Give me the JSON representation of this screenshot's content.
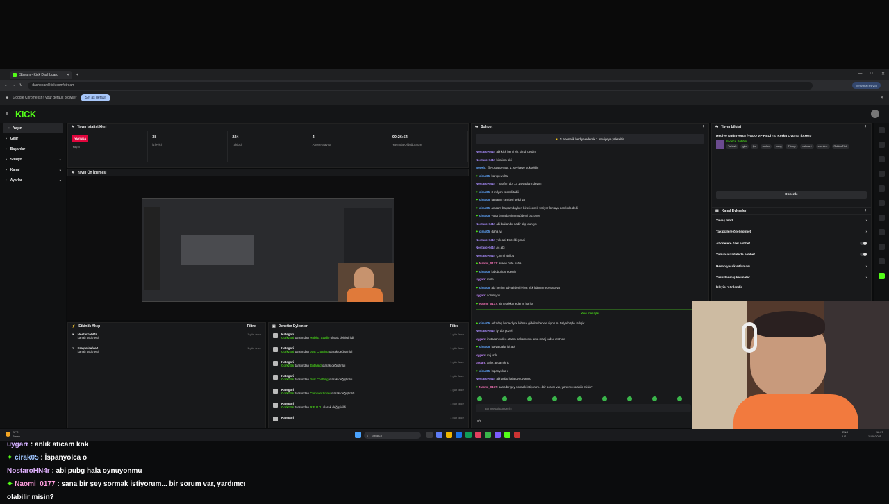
{
  "browser": {
    "tab_title": "Stream - Kick Dashboard",
    "url": "dashboard.kick.com/stream",
    "verify_label": "Verify that it's you",
    "infobar_text": "Google Chrome isn't your default browser",
    "set_default_label": "Set as default"
  },
  "brand": {
    "logo": "KICK",
    "accent": "#53fc18",
    "live_color": "#e1063d"
  },
  "sidebar": {
    "items": [
      {
        "label": "Yayın",
        "icon": "broadcast-icon"
      },
      {
        "label": "Gelir",
        "icon": "dollar-icon"
      },
      {
        "label": "Başarılar",
        "icon": "trophy-icon"
      },
      {
        "label": "Stüdyo",
        "icon": "studio-icon"
      },
      {
        "label": "Kanal",
        "icon": "channel-icon"
      },
      {
        "label": "Ayarlar",
        "icon": "gear-icon"
      }
    ]
  },
  "stats": {
    "title": "Yayın İstatistikleri",
    "live_badge": "YAYINDA",
    "items": [
      {
        "value": "",
        "label": "Yayın"
      },
      {
        "value": "38",
        "label": "İzleyici"
      },
      {
        "value": "224",
        "label": "Takipçi"
      },
      {
        "value": "4",
        "label": "Abone Sayısı"
      },
      {
        "value": "00:26:54",
        "label": "Yayında Olduğu Süre"
      }
    ]
  },
  "preview": {
    "title": "Yayın Ön İzlemesi"
  },
  "activity": {
    "title": "Etkinlik Akışı",
    "filter": "Filtre",
    "rows": [
      {
        "name": "NostaroHN4r",
        "action": "kanalı takip etti",
        "time": "1 gün önce"
      },
      {
        "name": "Erayrafeulva2",
        "action": "kanalı takip etti",
        "time": "1 gün önce"
      }
    ]
  },
  "moderation": {
    "title": "Denetim Eylemleri",
    "filter": "Filtre",
    "rows": [
      {
        "title": "Kategori",
        "by": "GorkzBal",
        "mid": "tarafından",
        "value": "Roblox Studio",
        "tail": "olarak değiştirildi",
        "time": "1 gün önce"
      },
      {
        "title": "Kategori",
        "by": "GorkzBal",
        "mid": "tarafından",
        "value": "Just Chatting",
        "tail": "olarak değiştirildi",
        "time": "1 gün önce"
      },
      {
        "title": "Kategori",
        "by": "GorkzBal",
        "mid": "tarafından",
        "value": "Entailed",
        "tail": "olarak değiştirildi",
        "time": "1 gün önce"
      },
      {
        "title": "Kategori",
        "by": "GorkzBal",
        "mid": "tarafından",
        "value": "Just Chatting",
        "tail": "olarak değiştirildi",
        "time": "1 gün önce"
      },
      {
        "title": "Kategori",
        "by": "GorkzBal",
        "mid": "tarafından",
        "value": "Crimson Snow",
        "tail": "olarak değiştirildi",
        "time": "1 gün önce"
      },
      {
        "title": "Kategori",
        "by": "GorkzBal",
        "mid": "tarafından",
        "value": "R.E.P.O.",
        "tail": "olarak değiştirildi",
        "time": "1 gün önce"
      },
      {
        "title": "Kategori",
        "by": "",
        "mid": "",
        "value": "",
        "tail": "",
        "time": "1 gün önce"
      }
    ]
  },
  "chat": {
    "title": "Sohbet",
    "pinned": "1 abonelik hediye ederek 1. seviyeye yükseltin",
    "new_messages": "Yeni mesajlar",
    "input_placeholder": "Bir mesaj gönderin",
    "count": "0/0",
    "lines": [
      {
        "u": "NostaroHN4r",
        "t": "abi kick benli ellt şimdi geldim",
        "c": "u1",
        "s": false
      },
      {
        "u": "NostaroHN4r",
        "t": "bilmiom abi",
        "c": "u1",
        "s": false
      },
      {
        "u": "BotRix",
        "t": "@NostaroHN4r, 1. seviyeye yükseldin",
        "c": "u2",
        "s": false
      },
      {
        "u": "cirak05",
        "t": "karışık volta",
        "c": "u2",
        "s": true
      },
      {
        "u": "NostaroHN4r",
        "t": "7 sırafım abi 13 14 yaşlarındayım",
        "c": "u1",
        "s": false
      },
      {
        "u": "cirak05",
        "t": "3 milyon istendi tabii",
        "c": "u2",
        "s": true
      },
      {
        "u": "cirak05",
        "t": "fantanın çeşitleri geldi ya",
        "c": "u2",
        "s": true
      },
      {
        "u": "cirak05",
        "t": "amcam bayramdayken bize içecek veriyor fantaya son kola dedi",
        "c": "u2",
        "s": true
      },
      {
        "u": "cirak05",
        "t": "volta fanta benim müğdemi bozuyor",
        "c": "u2",
        "s": true
      },
      {
        "u": "NostaroHN4r",
        "t": "abi bakandır nadir alıp duruyo",
        "c": "u1",
        "s": false
      },
      {
        "u": "cirak05",
        "t": "daha iyi",
        "c": "u2",
        "s": true
      },
      {
        "u": "NostaroHN4r",
        "t": "yok abi Düzeldi şimdi",
        "c": "u1",
        "s": false
      },
      {
        "u": "NostaroHN4r",
        "t": "Aç abi",
        "c": "u1",
        "s": false
      },
      {
        "u": "NostaroHN4r",
        "t": "Çin mi abi bu",
        "c": "u1",
        "s": false
      },
      {
        "u": "Naomi_0177",
        "t": "awww cute haha",
        "c": "u4",
        "s": true
      },
      {
        "u": "cirak05",
        "t": "lobubu icat edenin",
        "c": "u2",
        "s": true
      },
      {
        "u": "uygarr",
        "t": "mole",
        "c": "u3",
        "s": false
      },
      {
        "u": "cirak05",
        "t": "abi benim italya işleri iyi ya ırkk lidrını mecenası var",
        "c": "u2",
        "s": true
      },
      {
        "u": "uygarr",
        "t": "sorun yok",
        "c": "u3",
        "s": false
      },
      {
        "u": "Naomi_0177",
        "t": "ah teşekkür ederim ha ha",
        "c": "u4",
        "s": true
      }
    ],
    "lines_after": [
      {
        "u": "cirak05",
        "t": "arkadaş bana diyor lobnsa gidelim bende diyorum İtalya böyle tatlışik",
        "c": "u2",
        "s": true
      },
      {
        "u": "NostaroHN4r",
        "t": "iyi abi güzel",
        "c": "u1",
        "s": false
      },
      {
        "u": "uygarr",
        "t": "instadan video atsam bakarmısın ama marij kabul et önce",
        "c": "u3",
        "s": false
      },
      {
        "u": "cirak05",
        "t": "İtalya daha iyi abi",
        "c": "u2",
        "s": true
      },
      {
        "u": "uygarr",
        "t": "mıj knk",
        "c": "u3",
        "s": false
      },
      {
        "u": "uygarr",
        "t": "anlık atıcam knk",
        "c": "u3",
        "s": false
      },
      {
        "u": "cirak05",
        "t": "İspanyolca o",
        "c": "u2",
        "s": true
      },
      {
        "u": "NostaroHN4r",
        "t": "abi pubg hala oynuyonmu",
        "c": "u1",
        "s": false
      },
      {
        "u": "Naomi_0177",
        "t": "sana bir şey sormak istiyorum... bir sorum var, yardımcı olabilir misin?",
        "c": "u4",
        "s": true
      }
    ]
  },
  "stream_info": {
    "title": "Yayın bilgisi",
    "stream_title": "Hediye Dağıtıyoruz /VALO VP HEDİYE/ Korku Oyunu/ !bixerp",
    "category": "Sadece Sohbet",
    "tags": [
      "Turkish",
      "gta",
      "fps",
      "roblox",
      "pubg",
      "Türkçe",
      "valorant",
      "csonline",
      "RobloxTürk"
    ],
    "edit_label": "Düzenle"
  },
  "channel_actions": {
    "title": "Kanal Eylemleri",
    "items": [
      {
        "label": "Yavaş mod",
        "kind": "arrow"
      },
      {
        "label": "Takipçilere özel sohbet",
        "kind": "arrow"
      },
      {
        "label": "Abonelere özel sohbet",
        "kind": "toggle"
      },
      {
        "label": "Yalnızca ifadelerle sohbet",
        "kind": "toggle"
      },
      {
        "label": "Hesap yaşı kısıtlaması",
        "kind": "arrow"
      },
      {
        "label": "Yasaklanmış kelimeler",
        "kind": "arrow"
      },
      {
        "label": "İzleyici Yönlendir",
        "kind": "none"
      }
    ]
  },
  "taskbar": {
    "weather_temp": "28°C",
    "weather_desc": "Sunny",
    "search": "Search",
    "lang": "ENG",
    "lang2": "US",
    "clock": "18:07",
    "date": "11/08/2025"
  },
  "overlay_chat": [
    {
      "user": "uygarr",
      "text": " : anlık atıcam knk",
      "cls": "bc-u-a",
      "star": false
    },
    {
      "user": "cirak05",
      "text": " : İspanyolca o",
      "cls": "bc-u-b",
      "star": true
    },
    {
      "user": "NostaroHN4r",
      "text": " : abi pubg hala oynuyonmu",
      "cls": "bc-u-c",
      "star": false
    },
    {
      "user": "Naomi_0177",
      "text": " : sana bir şey sormak istiyorum... bir sorum var, yardımcı",
      "cls": "bc-u-d",
      "star": true
    },
    {
      "user": "",
      "text": "olabilir misin?",
      "cls": "",
      "star": false
    }
  ]
}
